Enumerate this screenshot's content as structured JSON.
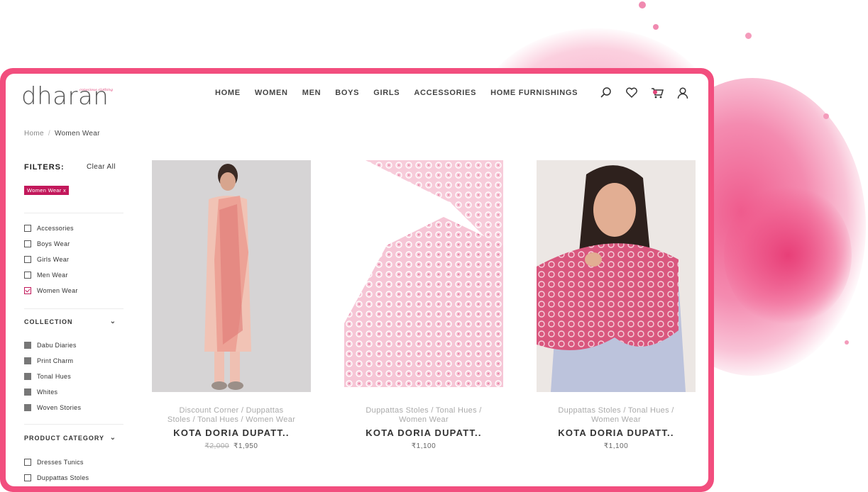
{
  "brand": {
    "logo": "dharan",
    "tagline": "conscious clothing"
  },
  "nav": [
    "HOME",
    "WOMEN",
    "MEN",
    "BOYS",
    "GIRLS",
    "ACCESSORIES",
    "HOME FURNISHINGS"
  ],
  "header_icons": [
    "search-icon",
    "heart-icon",
    "cart-icon",
    "user-icon"
  ],
  "colors": {
    "accent": "#f24e7e",
    "chip": "#c2185b",
    "text": "#333333"
  },
  "breadcrumb": {
    "home": "Home",
    "separator": "/",
    "current": "Women Wear"
  },
  "filters": {
    "title": "FILTERS:",
    "clear_all": "Clear All",
    "active_chip": "Women Wear x",
    "categories": [
      {
        "label": "Accessories",
        "checked": false
      },
      {
        "label": "Boys Wear",
        "checked": false
      },
      {
        "label": "Girls Wear",
        "checked": false
      },
      {
        "label": "Men Wear",
        "checked": false
      },
      {
        "label": "Women Wear",
        "checked": true
      }
    ],
    "collection": {
      "heading": "COLLECTION",
      "items": [
        "Dabu Diaries",
        "Print Charm",
        "Tonal Hues",
        "Whites",
        "Woven Stories"
      ]
    },
    "product_category": {
      "heading": "PRODUCT CATEGORY",
      "items": [
        "Dresses Tunics",
        "Duppattas Stoles"
      ]
    }
  },
  "products": [
    {
      "tags_line1": "Discount Corner / Duppattas",
      "tags_line2": "Stoles / Tonal Hues / Women Wear",
      "title": "KOTA DORIA DUPATT..",
      "old_price": "₹2,000",
      "price": "₹1,950"
    },
    {
      "tags_line1": "Duppattas Stoles / Tonal Hues /",
      "tags_line2": "Women Wear",
      "title": "KOTA DORIA DUPATT..",
      "old_price": "",
      "price": "₹1,100"
    },
    {
      "tags_line1": "Duppattas Stoles / Tonal Hues /",
      "tags_line2": "Women Wear",
      "title": "KOTA DORIA DUPATT..",
      "old_price": "",
      "price": "₹1,100"
    }
  ]
}
